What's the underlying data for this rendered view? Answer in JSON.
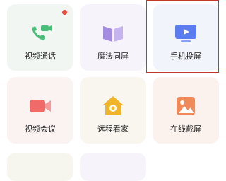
{
  "tiles": [
    {
      "id": "video-call",
      "label": "视频通话",
      "icon": "video-call-icon",
      "has_badge": true
    },
    {
      "id": "magic-sync",
      "label": "魔法同屏",
      "icon": "magic-screen-icon",
      "has_badge": false
    },
    {
      "id": "screen-cast",
      "label": "手机投屏",
      "icon": "monitor-cast-icon",
      "has_badge": false,
      "selected": true
    },
    {
      "id": "video-meeting",
      "label": "视频会议",
      "icon": "video-camera-icon",
      "has_badge": false
    },
    {
      "id": "remote-home",
      "label": "远程看家",
      "icon": "home-camera-icon",
      "has_badge": false
    },
    {
      "id": "online-screenshot",
      "label": "在线截屏",
      "icon": "screenshot-icon",
      "has_badge": false
    }
  ],
  "colors": {
    "badge": "#e74c3c",
    "selection_frame": "#c0392b",
    "green": "#4bbf7a",
    "purple": "#a48ce0",
    "blue": "#5a7cf0",
    "red": "#f06a6a",
    "yellow": "#f0b429",
    "orange": "#f08a5a"
  }
}
